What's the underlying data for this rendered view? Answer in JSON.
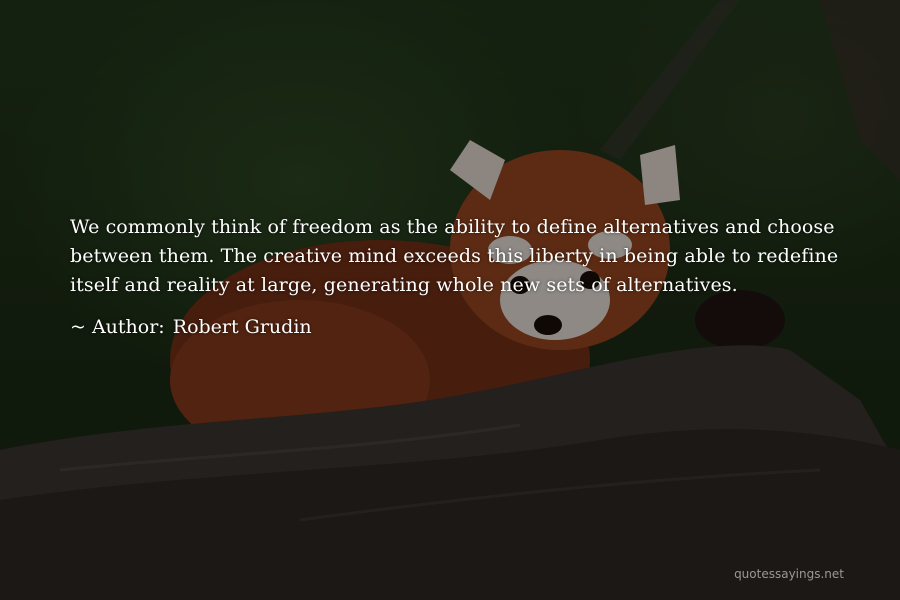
{
  "quote": {
    "text": "We commonly think of freedom as the ability to define alternatives and choose between them. The creative mind exceeds this liberty in being able to redefine itself and reality at large, generating whole new sets of alternatives.",
    "author_prefix": "~ Author:",
    "author_name": "Robert Grudin"
  },
  "watermark": {
    "text": "quotessayings.net"
  },
  "background": {
    "subject": "red panda resting on a tree branch",
    "colors": {
      "foliage": "#253a1d",
      "fur": "#8a3a1a",
      "branch": "#3a3530"
    }
  }
}
